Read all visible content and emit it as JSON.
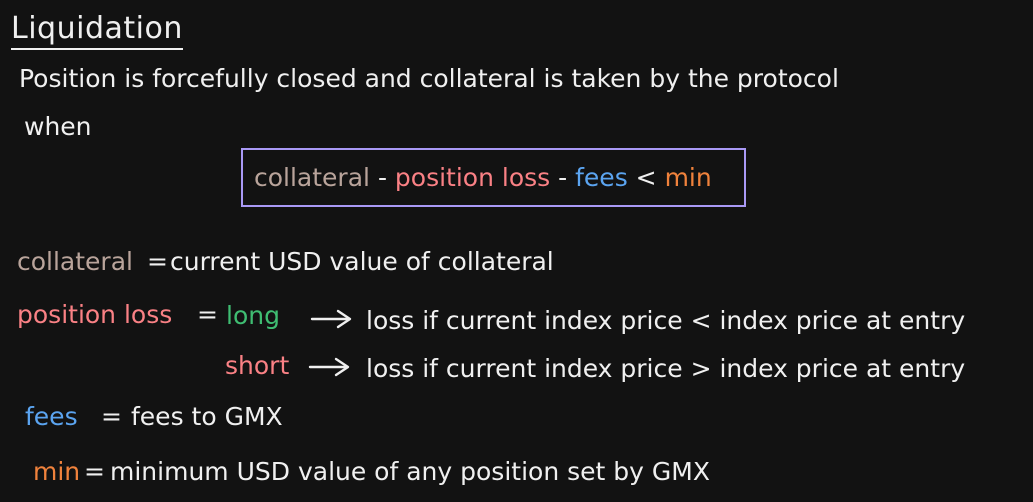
{
  "title": "Liquidation",
  "intro_line1": "Position is forcefully closed and collateral is taken by the protocol",
  "intro_line2": "when",
  "formula": {
    "collateral": "collateral",
    "minus1": "-",
    "position_loss": "position loss",
    "minus2": "-",
    "fees": "fees",
    "less_than": "<",
    "min": "min"
  },
  "definitions": {
    "collateral": {
      "term": "collateral",
      "equals": "=",
      "text": "current USD value of collateral"
    },
    "position_loss": {
      "term": "position loss",
      "equals": "=",
      "long": {
        "term": "long",
        "text": "loss if current index price < index price at entry"
      },
      "short": {
        "term": "short",
        "text": "loss if current index price > index price at entry"
      }
    },
    "fees": {
      "term": "fees",
      "equals": "=",
      "text": "fees to GMX"
    },
    "min": {
      "term": "min",
      "equals": "=",
      "text": "minimum USD value of any position set by GMX"
    }
  },
  "colors": {
    "background": "#121212",
    "text": "#f0f0f0",
    "collateral": "#b9a49b",
    "position_loss": "#fa8185",
    "fees": "#5ba4f0",
    "min": "#f0823c",
    "long": "#3fbd72",
    "short": "#fa8185",
    "box_border": "#a999f5"
  },
  "icons": {
    "arrow": "right-arrow-icon"
  }
}
